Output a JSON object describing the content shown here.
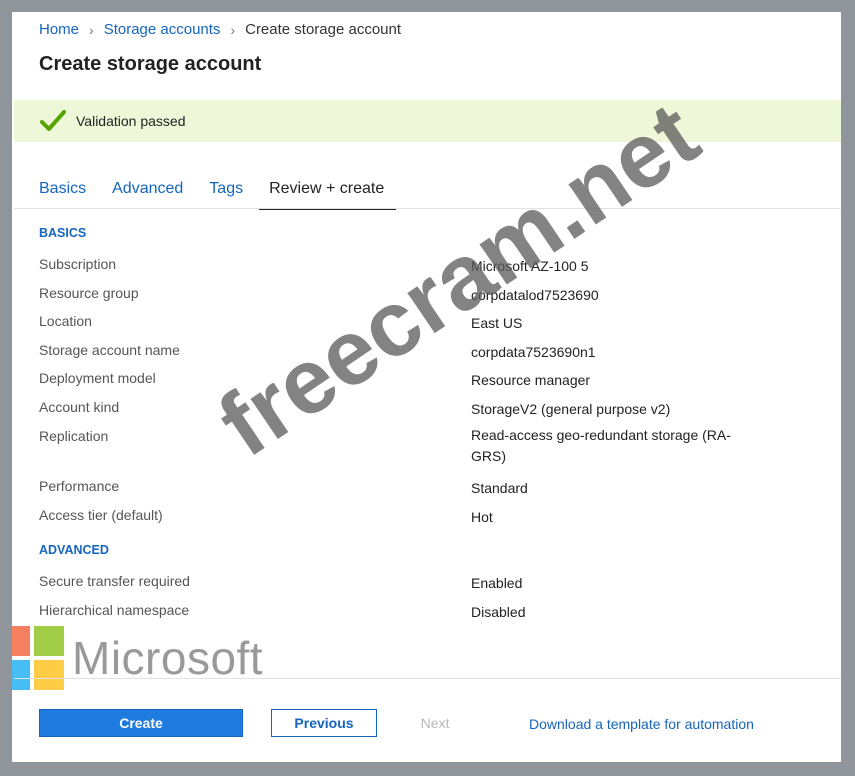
{
  "breadcrumb": {
    "items": [
      "Home",
      "Storage accounts"
    ],
    "current": "Create storage account",
    "separator": ">"
  },
  "page_title": "Create storage account",
  "validation": {
    "icon": "check-icon",
    "text": "Validation passed",
    "color": "#eef7d7"
  },
  "tabs": [
    {
      "label": "Basics",
      "active": false
    },
    {
      "label": "Advanced",
      "active": false
    },
    {
      "label": "Tags",
      "active": false
    },
    {
      "label": "Review + create",
      "active": true
    }
  ],
  "basics": {
    "heading": "BASICS",
    "rows": [
      {
        "label": "Subscription",
        "value": "Microsoft AZ-100 5"
      },
      {
        "label": "Resource group",
        "value": "corpdatalod7523690"
      },
      {
        "label": "Location",
        "value": "East US"
      },
      {
        "label": "Storage account name",
        "value": "corpdata7523690n1"
      },
      {
        "label": "Deployment model",
        "value": "Resource manager"
      },
      {
        "label": "Account kind",
        "value": "StorageV2 (general purpose v2)"
      },
      {
        "label": "Replication",
        "value": "Read-access geo-redundant storage (RA-GRS)"
      },
      {
        "label": "Performance",
        "value": "Standard"
      },
      {
        "label": "Access tier (default)",
        "value": "Hot"
      }
    ]
  },
  "advanced": {
    "heading": "ADVANCED",
    "rows": [
      {
        "label": "Secure transfer required",
        "value": "Enabled"
      },
      {
        "label": "Hierarchical namespace",
        "value": "Disabled"
      }
    ]
  },
  "footer": {
    "create_label": "Create",
    "previous_label": "Previous",
    "next_label": "Next",
    "template_link": "Download a template for automation"
  },
  "logo": {
    "wordmark": "Microsoft",
    "colors": [
      "#f25022",
      "#7fba00",
      "#00a4ef",
      "#ffb900"
    ]
  },
  "watermark": "freecram.net",
  "colors": {
    "accent": "#1565c0",
    "primary_button": "#1f7be0"
  }
}
